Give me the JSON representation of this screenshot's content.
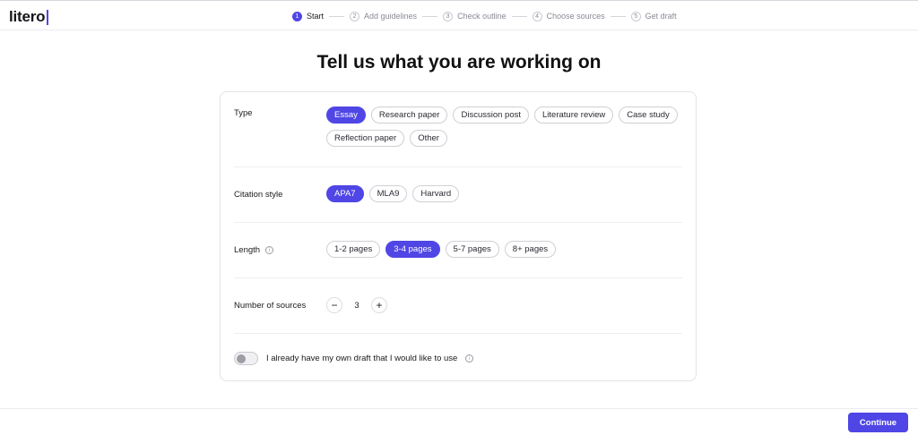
{
  "app": {
    "logo_text": "litero"
  },
  "stepper": {
    "steps": [
      {
        "num": "1",
        "label": "Start"
      },
      {
        "num": "2",
        "label": "Add guidelines"
      },
      {
        "num": "3",
        "label": "Check outline"
      },
      {
        "num": "4",
        "label": "Choose sources"
      },
      {
        "num": "5",
        "label": "Get draft"
      }
    ],
    "active_step": "1"
  },
  "page": {
    "title": "Tell us what you are working on"
  },
  "form": {
    "type": {
      "label": "Type",
      "options": [
        "Essay",
        "Research paper",
        "Discussion post",
        "Literature review",
        "Case study",
        "Reflection paper",
        "Other"
      ],
      "selected": "Essay"
    },
    "citation": {
      "label": "Citation style",
      "options": [
        "APA7",
        "MLA9",
        "Harvard"
      ],
      "selected": "APA7"
    },
    "length": {
      "label": "Length",
      "info_icon": "i",
      "options": [
        "1-2 pages",
        "3-4 pages",
        "5-7 pages",
        "8+ pages"
      ],
      "selected": "3-4 pages"
    },
    "sources": {
      "label": "Number of sources",
      "minus": "−",
      "value": "3",
      "plus": "+"
    },
    "own_draft": {
      "label": "I already have my own draft that I would like to use",
      "info_icon": "i",
      "enabled": false
    }
  },
  "footer": {
    "continue_label": "Continue"
  },
  "colors": {
    "accent": "#4f46e5"
  }
}
